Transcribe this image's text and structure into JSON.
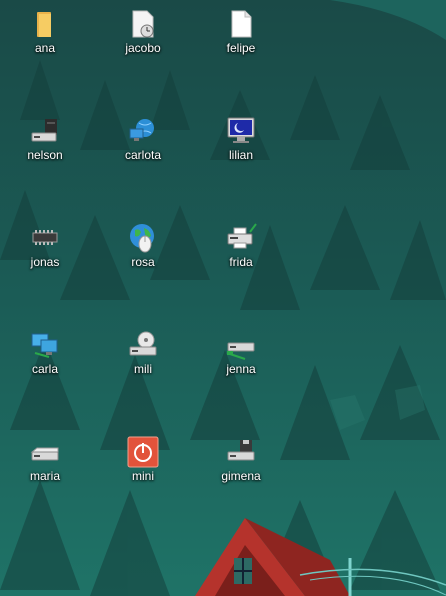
{
  "desktop": {
    "icons": [
      {
        "label": "ana",
        "icon": "folder-icon"
      },
      {
        "label": "jacobo",
        "icon": "document-clock-icon"
      },
      {
        "label": "felipe",
        "icon": "blank-document-icon"
      },
      {
        "label": "nelson",
        "icon": "server-drive-icon"
      },
      {
        "label": "carlota",
        "icon": "network-globe-icon"
      },
      {
        "label": "lilian",
        "icon": "monitor-icon"
      },
      {
        "label": "jonas",
        "icon": "memory-chip-icon"
      },
      {
        "label": "rosa",
        "icon": "globe-mouse-icon"
      },
      {
        "label": "frida",
        "icon": "printer-icon"
      },
      {
        "label": "carla",
        "icon": "network-monitors-icon"
      },
      {
        "label": "mili",
        "icon": "optical-drive-icon"
      },
      {
        "label": "jenna",
        "icon": "drive-with-cable-icon"
      },
      {
        "label": "maria",
        "icon": "hard-drive-icon"
      },
      {
        "label": "mini",
        "icon": "power-button-icon"
      },
      {
        "label": "gimena",
        "icon": "floppy-drive-icon"
      }
    ]
  }
}
